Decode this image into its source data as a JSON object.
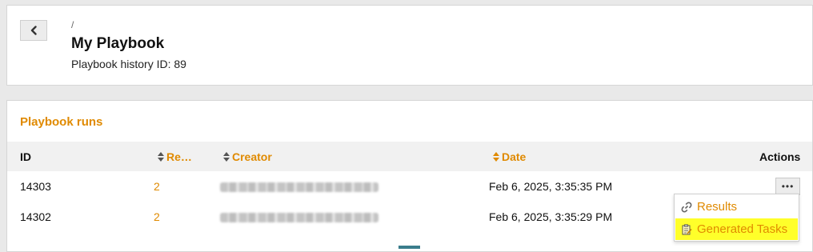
{
  "header": {
    "breadcrumb": "/",
    "title": "My Playbook",
    "subtitle": "Playbook history ID: 89",
    "back_icon": "chevron-left-icon"
  },
  "runs": {
    "title": "Playbook runs",
    "columns": {
      "id": "ID",
      "results": "Re…",
      "creator": "Creator",
      "date": "Date",
      "actions": "Actions"
    },
    "rows": [
      {
        "id": "14303",
        "results": "2",
        "date": "Feb 6, 2025, 3:35:35 PM"
      },
      {
        "id": "14302",
        "results": "2",
        "date": "Feb 6, 2025, 3:35:29 PM"
      }
    ],
    "menu_button_label": "•••"
  },
  "dropdown": {
    "items": [
      {
        "label": "Results",
        "icon": "link-icon"
      },
      {
        "label": "Generated Tasks",
        "icon": "task-icon"
      }
    ]
  },
  "colors": {
    "accent": "#e08a00",
    "highlight": "#ffff2a",
    "background": "#e9e9e9"
  }
}
